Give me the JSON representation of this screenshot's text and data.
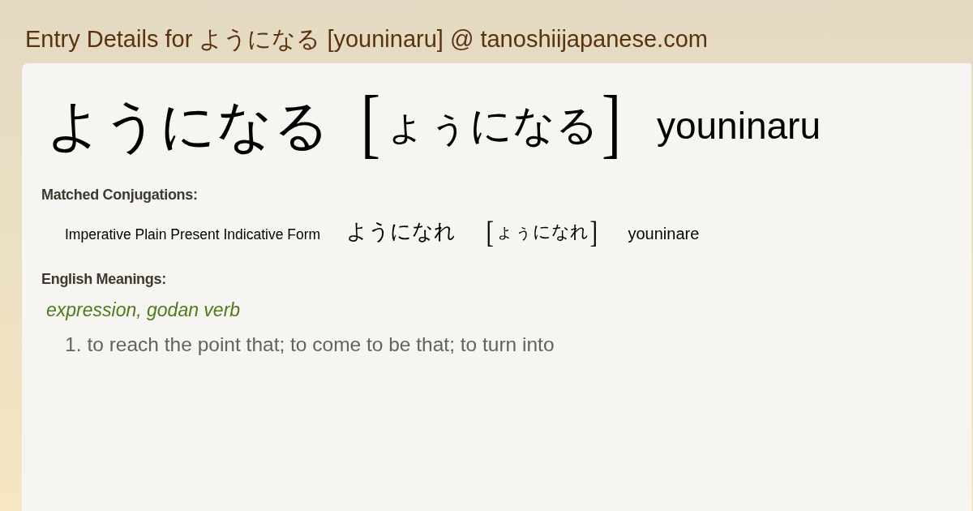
{
  "page_title": "Entry Details for ようになる [youninaru] @ tanoshiijapanese.com",
  "entry": {
    "word": "ようになる",
    "reading": {
      "open": "[",
      "text": "ょぅになる",
      "close": "]"
    },
    "romaji": "youninaru"
  },
  "conjugations": {
    "heading": "Matched Conjugations:",
    "items": [
      {
        "form": "Imperative Plain Present Indicative Form",
        "word": "ようになれ",
        "reading": {
          "open": "[",
          "text": "ょぅになれ",
          "close": "]"
        },
        "romaji": "youninare"
      }
    ]
  },
  "meanings": {
    "heading": "English Meanings:",
    "part_of_speech": "expression, godan verb",
    "items": [
      {
        "number": "1.",
        "text": "to reach the point that; to come to be that; to turn into"
      }
    ]
  }
}
